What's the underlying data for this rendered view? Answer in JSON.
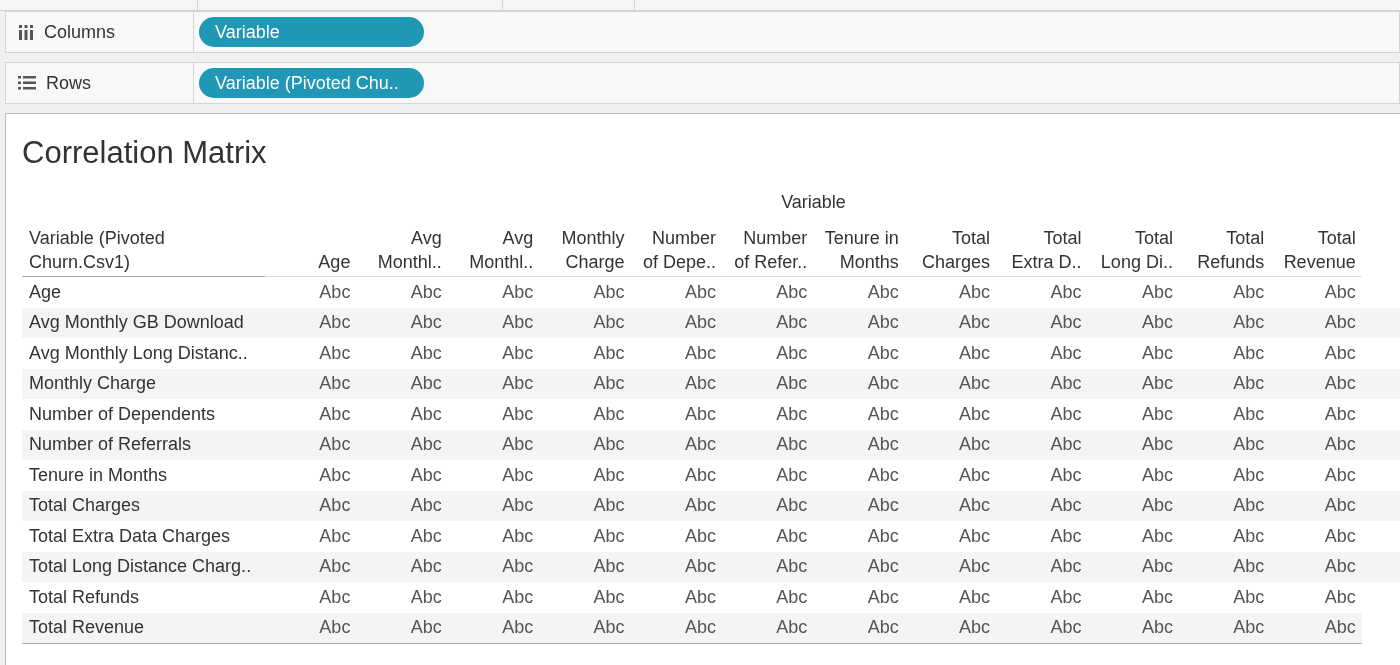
{
  "shelves": [
    {
      "kind": "columns",
      "label": "Columns",
      "pill": "Variable"
    },
    {
      "kind": "rows",
      "label": "Rows",
      "pill": "Variable (Pivoted Chu.."
    }
  ],
  "view": {
    "title": "Correlation Matrix",
    "column_group": "Variable",
    "row_header": [
      "Variable (Pivoted",
      "Churn.Csv1)"
    ],
    "columns": [
      {
        "lines": [
          "Age"
        ]
      },
      {
        "lines": [
          "Avg",
          "Monthl.."
        ]
      },
      {
        "lines": [
          "Avg",
          "Monthl.."
        ]
      },
      {
        "lines": [
          "Monthly",
          "Charge"
        ]
      },
      {
        "lines": [
          "Number",
          "of Depe.."
        ]
      },
      {
        "lines": [
          "Number",
          "of Refer.."
        ]
      },
      {
        "lines": [
          "Tenure in",
          "Months"
        ]
      },
      {
        "lines": [
          "Total",
          "Charges"
        ]
      },
      {
        "lines": [
          "Total",
          "Extra D.."
        ]
      },
      {
        "lines": [
          "Total",
          "Long Di.."
        ]
      },
      {
        "lines": [
          "Total",
          "Refunds"
        ]
      },
      {
        "lines": [
          "Total",
          "Revenue"
        ]
      }
    ],
    "rows": [
      {
        "label": "Age",
        "cells": [
          "Abc",
          "Abc",
          "Abc",
          "Abc",
          "Abc",
          "Abc",
          "Abc",
          "Abc",
          "Abc",
          "Abc",
          "Abc",
          "Abc"
        ]
      },
      {
        "label": "Avg Monthly GB Download",
        "cells": [
          "Abc",
          "Abc",
          "Abc",
          "Abc",
          "Abc",
          "Abc",
          "Abc",
          "Abc",
          "Abc",
          "Abc",
          "Abc",
          "Abc"
        ]
      },
      {
        "label": "Avg Monthly Long Distanc..",
        "cells": [
          "Abc",
          "Abc",
          "Abc",
          "Abc",
          "Abc",
          "Abc",
          "Abc",
          "Abc",
          "Abc",
          "Abc",
          "Abc",
          "Abc"
        ]
      },
      {
        "label": "Monthly Charge",
        "cells": [
          "Abc",
          "Abc",
          "Abc",
          "Abc",
          "Abc",
          "Abc",
          "Abc",
          "Abc",
          "Abc",
          "Abc",
          "Abc",
          "Abc"
        ]
      },
      {
        "label": "Number of Dependents",
        "cells": [
          "Abc",
          "Abc",
          "Abc",
          "Abc",
          "Abc",
          "Abc",
          "Abc",
          "Abc",
          "Abc",
          "Abc",
          "Abc",
          "Abc"
        ]
      },
      {
        "label": "Number of Referrals",
        "cells": [
          "Abc",
          "Abc",
          "Abc",
          "Abc",
          "Abc",
          "Abc",
          "Abc",
          "Abc",
          "Abc",
          "Abc",
          "Abc",
          "Abc"
        ]
      },
      {
        "label": "Tenure in Months",
        "cells": [
          "Abc",
          "Abc",
          "Abc",
          "Abc",
          "Abc",
          "Abc",
          "Abc",
          "Abc",
          "Abc",
          "Abc",
          "Abc",
          "Abc"
        ]
      },
      {
        "label": "Total Charges",
        "cells": [
          "Abc",
          "Abc",
          "Abc",
          "Abc",
          "Abc",
          "Abc",
          "Abc",
          "Abc",
          "Abc",
          "Abc",
          "Abc",
          "Abc"
        ]
      },
      {
        "label": "Total Extra Data Charges",
        "cells": [
          "Abc",
          "Abc",
          "Abc",
          "Abc",
          "Abc",
          "Abc",
          "Abc",
          "Abc",
          "Abc",
          "Abc",
          "Abc",
          "Abc"
        ]
      },
      {
        "label": "Total Long Distance Charg..",
        "cells": [
          "Abc",
          "Abc",
          "Abc",
          "Abc",
          "Abc",
          "Abc",
          "Abc",
          "Abc",
          "Abc",
          "Abc",
          "Abc",
          "Abc"
        ]
      },
      {
        "label": "Total Refunds",
        "cells": [
          "Abc",
          "Abc",
          "Abc",
          "Abc",
          "Abc",
          "Abc",
          "Abc",
          "Abc",
          "Abc",
          "Abc",
          "Abc",
          "Abc"
        ]
      },
      {
        "label": "Total Revenue",
        "cells": [
          "Abc",
          "Abc",
          "Abc",
          "Abc",
          "Abc",
          "Abc",
          "Abc",
          "Abc",
          "Abc",
          "Abc",
          "Abc",
          "Abc"
        ]
      }
    ]
  }
}
